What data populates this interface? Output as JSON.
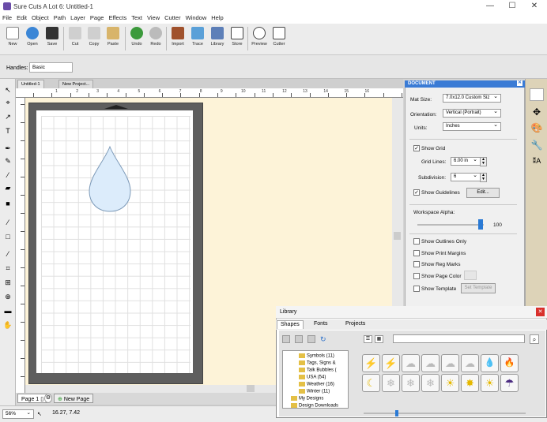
{
  "window": {
    "title": "Sure Cuts A Lot 6: Untitled-1",
    "minimize": "—",
    "maximize": "☐",
    "close": "✕"
  },
  "menu": [
    "File",
    "Edit",
    "Object",
    "Path",
    "Layer",
    "Page",
    "Effects",
    "Text",
    "View",
    "Cutter",
    "Window",
    "Help"
  ],
  "toolbar": {
    "new": "New",
    "open": "Open",
    "save": "Save",
    "cut": "Cut",
    "copy": "Copy",
    "paste": "Paste",
    "undo": "Undo",
    "redo": "Redo",
    "import": "Import",
    "trace": "Trace",
    "library": "Library",
    "store": "Store",
    "preview": "Preview",
    "cutter": "Cutter"
  },
  "handles": {
    "label": "Handles:",
    "value": "Basic"
  },
  "doc_tabs": {
    "tab1": "Untitled-1",
    "tab2": "New Project..."
  },
  "ruler_numbers": [
    "1",
    "2",
    "3",
    "4",
    "5",
    "6",
    "7",
    "8",
    "9",
    "10",
    "11",
    "12",
    "13",
    "14",
    "15",
    "16"
  ],
  "pages": {
    "page1": "Page 1",
    "new_page": "New Page"
  },
  "status": {
    "zoom": "56%",
    "coords": "16.27, 7.42"
  },
  "document_panel": {
    "header": "DOCUMENT",
    "mat_size_label": "Mat Size:",
    "mat_size_value": "7.0x12.0 Custom Siz",
    "orientation_label": "Orientation:",
    "orientation_value": "Vertical (Portrait)",
    "units_label": "Units:",
    "units_value": "Inches",
    "show_grid": "Show Grid",
    "grid_lines_label": "Grid Lines:",
    "grid_lines_value": "6.00 in",
    "subdivision_label": "Subdivision:",
    "subdivision_value": "6",
    "show_guidelines": "Show Guidelines",
    "edit_btn": "Edit...",
    "workspace_alpha_label": "Workspace Alpha:",
    "workspace_alpha_value": "100",
    "show_outlines_only": "Show Outlines Only",
    "show_print_margins": "Show Print Margins",
    "show_reg_marks": "Show Reg Marks",
    "show_page_color": "Show Page Color",
    "show_template": "Show Template",
    "set_template_btn": "Set Template"
  },
  "library": {
    "title": "Library",
    "tab_shapes": "Shapes",
    "tab_fonts": "Fonts",
    "tab_projects": "Projects",
    "tree": [
      "Symbols (11)",
      "Tags, Signs &",
      "Talk Bubbles (",
      "USA (54)",
      "Weather (16)",
      "Winter (11)",
      "My Designs",
      "Design Downloads"
    ],
    "shapes": [
      "⚡",
      "⚡",
      "☁",
      "☁",
      "☁",
      "☁",
      "💧",
      "🔥",
      "☾",
      "❄",
      "❄",
      "❄",
      "☀",
      "✸",
      "☀",
      "☂"
    ],
    "shape_names": [
      "lightning-1",
      "lightning-2",
      "cloud-1",
      "cloud-2",
      "cloud-3",
      "cloud-4",
      "raindrop",
      "flame",
      "crescent-moon",
      "snowflake-1",
      "snowflake-2",
      "snowflake-3",
      "sun-1",
      "sunburst",
      "sun-2",
      "umbrella"
    ]
  }
}
